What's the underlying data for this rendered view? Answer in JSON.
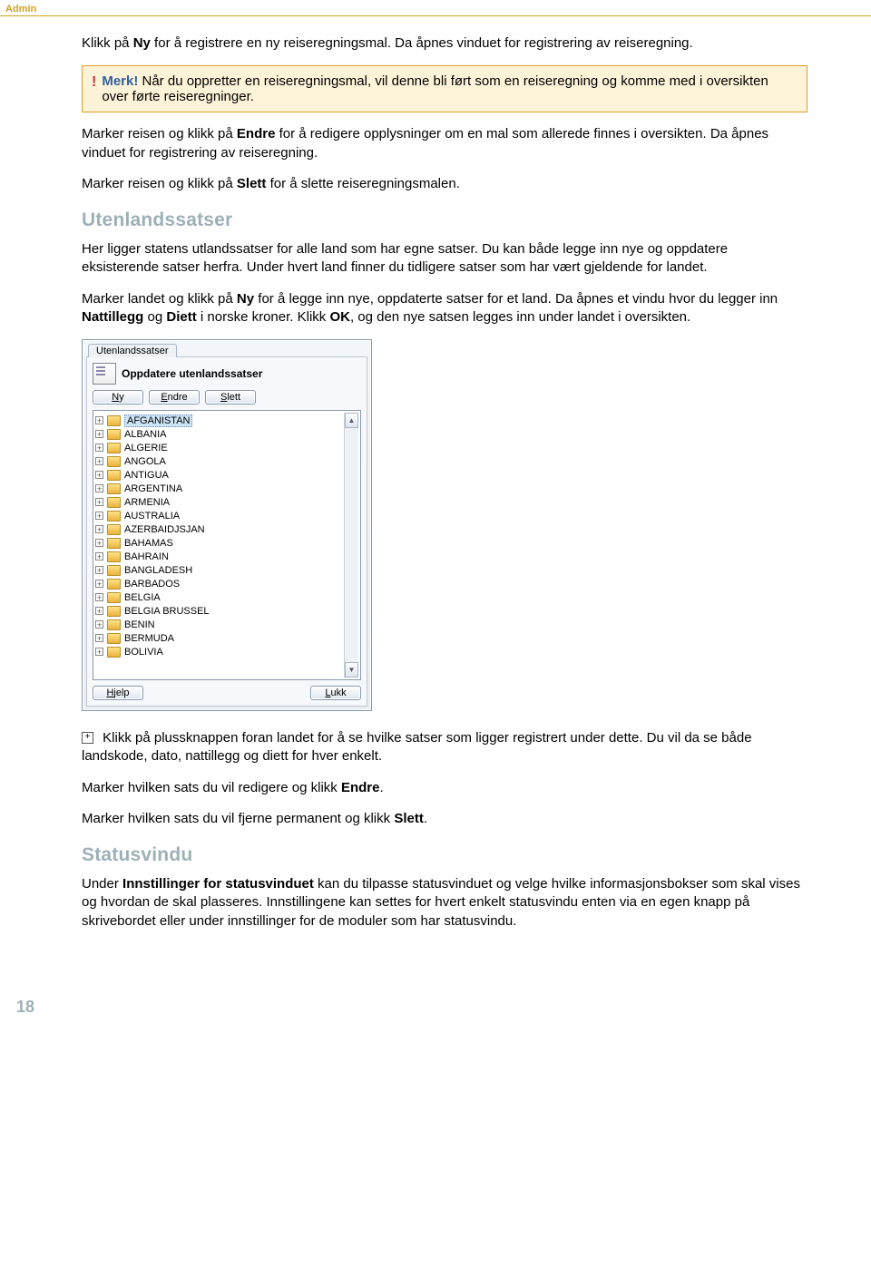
{
  "header_tag": "Admin",
  "intro_pre": "Klikk på ",
  "intro_bold": "Ny",
  "intro_post": " for å registrere en ny reiseregningsmal. Da åpnes vinduet for registrering av reiseregning.",
  "callout": {
    "title": "Merk!",
    "text": " Når du oppretter en reiseregningsmal, vil denne bli ført som en reiseregning og komme med i oversikten over førte reiseregninger."
  },
  "p2_pre": "Marker reisen og klikk på ",
  "p2_bold": "Endre",
  "p2_post": " for å redigere opplysninger om en mal som allerede finnes i oversikten. Da åpnes vinduet for registrering av reiseregning.",
  "p3_pre": "Marker reisen og klikk på ",
  "p3_bold": "Slett",
  "p3_post": " for å slette reiseregningsmalen.",
  "section1": "Utenlandssatser",
  "p4": "Her ligger statens utlandssatser for alle land som har egne satser. Du kan både legge inn nye og oppdatere eksisterende satser herfra. Under hvert land finner du tidligere satser som har vært gjeldende for landet.",
  "p5_pre": "Marker landet og klikk på ",
  "p5_b1": "Ny",
  "p5_mid1": " for å legge inn nye, oppdaterte satser for et land. Da åpnes et vindu hvor du legger inn ",
  "p5_b2": "Nattillegg",
  "p5_mid2": " og ",
  "p5_b3": "Diett",
  "p5_mid3": " i norske kroner. Klikk ",
  "p5_b4": "OK",
  "p5_post": ", og den nye satsen legges inn under landet i oversikten.",
  "dialog": {
    "tab": "Utenlandssatser",
    "title": "Oppdatere utenlandssatser",
    "buttons": {
      "ny_u": "N",
      "ny_r": "y",
      "endre_u": "E",
      "endre_r": "ndre",
      "slett_u": "S",
      "slett_r": "lett",
      "hjelp_u": "H",
      "hjelp_r": "jelp",
      "lukk_u": "L",
      "lukk_r": "ukk"
    },
    "countries": [
      "AFGANISTAN",
      "ALBANIA",
      "ALGERIE",
      "ANGOLA",
      "ANTIGUA",
      "ARGENTINA",
      "ARMENIA",
      "AUSTRALIA",
      "AZERBAIDJSJAN",
      "BAHAMAS",
      "BAHRAIN",
      "BANGLADESH",
      "BARBADOS",
      "BELGIA",
      "BELGIA BRUSSEL",
      "BENIN",
      "BERMUDA",
      "BOLIVIA"
    ]
  },
  "plus_sym": "+",
  "p6": " Klikk på plussknappen foran landet for å se hvilke satser som ligger registrert under dette. Du vil da se både landskode, dato, nattillegg og diett for hver enkelt.",
  "p7_pre": "Marker hvilken sats du vil redigere og klikk ",
  "p7_bold": "Endre",
  "p7_post": ".",
  "p8_pre": "Marker hvilken sats du vil fjerne permanent og klikk ",
  "p8_bold": "Slett",
  "p8_post": ".",
  "section2": "Statusvindu",
  "p9_pre": "Under ",
  "p9_bold": "Innstillinger for statusvinduet",
  "p9_post": " kan du tilpasse statusvinduet og velge hvilke informasjonsbokser som skal vises og hvordan de skal plasseres. Innstillingene kan settes for hvert enkelt statusvindu enten via en egen knapp på skrivebordet eller under innstillinger for de moduler som har statusvindu.",
  "page_number": "18"
}
